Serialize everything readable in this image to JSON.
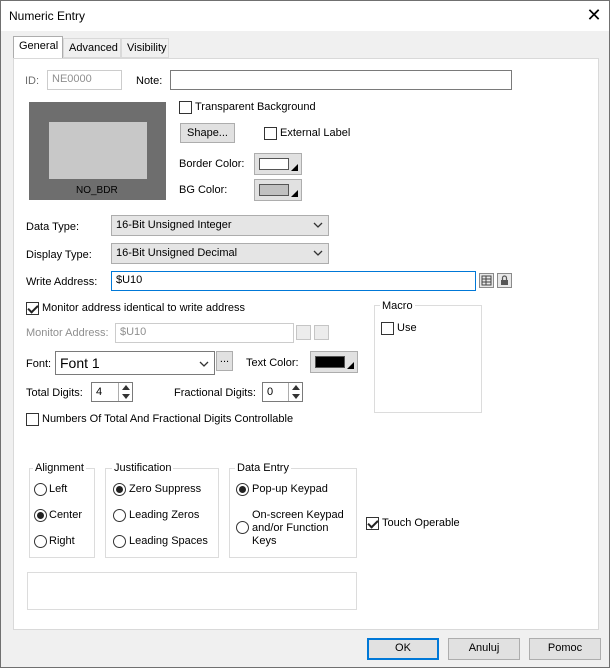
{
  "window": {
    "title": "Numeric Entry",
    "close_label": "✕"
  },
  "tabs": [
    {
      "label": "General"
    },
    {
      "label": "Advanced"
    },
    {
      "label": "Visibility"
    }
  ],
  "general": {
    "id_label": "ID:",
    "id_value": "NE0000",
    "note_label": "Note:",
    "note_value": "",
    "preview_caption": "NO_BDR",
    "transparent_bg_label": "Transparent Background",
    "shape_button": "Shape...",
    "external_label_label": "External Label",
    "border_color_label": "Border Color:",
    "bg_color_label": "BG Color:",
    "data_type_label": "Data Type:",
    "data_type_value": "16-Bit Unsigned Integer",
    "display_type_label": "Display Type:",
    "display_type_value": "16-Bit Unsigned Decimal",
    "write_address_label": "Write Address:",
    "write_address_value": "$U10",
    "monitor_identical_label": "Monitor address identical to write address",
    "monitor_address_label": "Monitor Address:",
    "monitor_address_value": "$U10",
    "macro_title": "Macro",
    "macro_use_label": "Use",
    "font_label": "Font:",
    "font_value": "Font 1",
    "font_ellipsis": "...",
    "text_color_label": "Text Color:",
    "total_digits_label": "Total Digits:",
    "total_digits_value": "4",
    "fractional_digits_label": "Fractional Digits:",
    "fractional_digits_value": "0",
    "digits_controllable_label": "Numbers Of Total And Fractional Digits Controllable",
    "alignment": {
      "title": "Alignment",
      "options": [
        "Left",
        "Center",
        "Right"
      ],
      "selected": "Center"
    },
    "justification": {
      "title": "Justification",
      "options": [
        "Zero Suppress",
        "Leading Zeros",
        "Leading Spaces"
      ],
      "selected": "Zero Suppress"
    },
    "data_entry": {
      "title": "Data Entry",
      "option1": "Pop-up Keypad",
      "option2_line1": "On-screen Keypad",
      "option2_line2": "and/or Function",
      "option2_line3": "Keys",
      "selected": "Pop-up Keypad"
    },
    "touch_operable_label": "Touch Operable"
  },
  "colors": {
    "border_color": "#ffffff",
    "bg_color": "#c0c0c0",
    "text_color": "#000000",
    "preview_outer": "#6e6e6e",
    "preview_inner": "#c8c8c8"
  },
  "footer": {
    "ok": "OK",
    "cancel": "Anuluj",
    "help": "Pomoc"
  }
}
